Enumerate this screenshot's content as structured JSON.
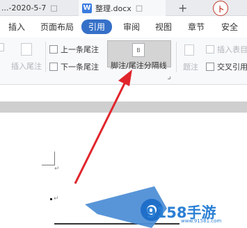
{
  "titlebar": {
    "tab1_label": "...-2020-5-7",
    "tab1_close": "□",
    "tab2_app_icon": "W",
    "tab2_label": "整理.docx",
    "tab2_close": "□",
    "add_tab": "+",
    "avatar": "卜"
  },
  "ribbon_tabs": [
    "插入",
    "页面布局",
    "引用",
    "审阅",
    "视图",
    "章节",
    "安全"
  ],
  "active_tab": "引用",
  "toolbar": {
    "insert_endnote_left": "插入尾注",
    "prev_endnote": "上一条尾注",
    "next_endnote": "下一条尾注",
    "separator_line": "脚注/尾注分隔线",
    "insert_caption": "插入表目",
    "caption_short": "题注",
    "cross_ref": "交叉引用",
    "icon_letter": "B"
  },
  "annotation": {
    "arrow_color": "#e0262c"
  },
  "watermark": {
    "text": "9158手游",
    "url": "www.91581.com"
  },
  "document": {
    "para_mark": "↵"
  }
}
